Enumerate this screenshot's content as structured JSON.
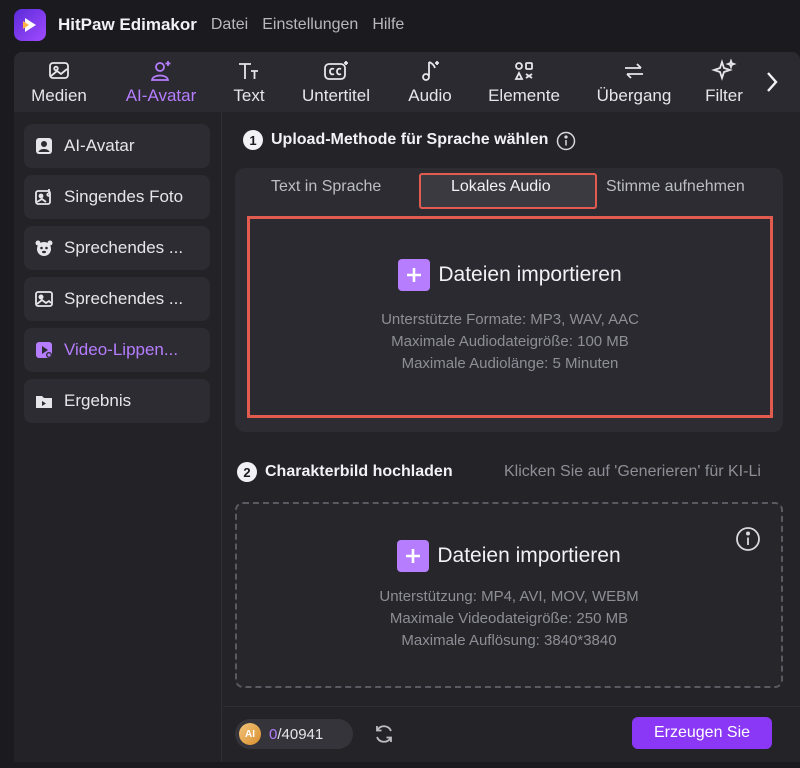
{
  "app": {
    "name": "HitPaw Edimakor"
  },
  "menu": [
    "Datei",
    "Einstellungen",
    "Hilfe"
  ],
  "toolbar": {
    "items": [
      {
        "label": "Medien",
        "icon": "media-icon"
      },
      {
        "label": "AI-Avatar",
        "icon": "ai-avatar-icon",
        "active": true
      },
      {
        "label": "Text",
        "icon": "text-icon"
      },
      {
        "label": "Untertitel",
        "icon": "subtitle-icon"
      },
      {
        "label": "Audio",
        "icon": "audio-icon"
      },
      {
        "label": "Elemente",
        "icon": "elements-icon"
      },
      {
        "label": "Übergang",
        "icon": "transition-icon"
      },
      {
        "label": "Filter",
        "icon": "filter-icon"
      }
    ],
    "next_icon": "chevron-right-icon"
  },
  "sidebar": {
    "items": [
      {
        "label": "AI-Avatar",
        "icon": "avatar-icon"
      },
      {
        "label": "Singendes Foto",
        "icon": "singing-photo-icon"
      },
      {
        "label": "Sprechendes ...",
        "icon": "talking-animal-icon"
      },
      {
        "label": "Sprechendes ...",
        "icon": "talking-photo-icon"
      },
      {
        "label": "Video-Lippen...",
        "icon": "lip-sync-icon",
        "active": true
      },
      {
        "label": "Ergebnis",
        "icon": "result-icon"
      }
    ]
  },
  "step1": {
    "number": "1",
    "title": "Upload-Methode für Sprache wählen",
    "tabs": [
      "Text in Sprache",
      "Lokales Audio",
      "Stimme aufnehmen"
    ],
    "selected_tab": "Lokales Audio",
    "import_label": "Dateien importieren",
    "notes": [
      "Unterstützte Formate: MP3, WAV, AAC",
      "Maximale Audiodateigröße: 100 MB",
      "Maximale Audiolänge: 5 Minuten"
    ]
  },
  "step2": {
    "number": "2",
    "title": "Charakterbild hochladen",
    "hint": "Klicken Sie auf 'Generieren' für KI-Li",
    "import_label": "Dateien importieren",
    "notes": [
      "Unterstützung: MP4, AVI, MOV, WEBM",
      "Maximale Videodateigröße: 250 MB",
      "Maximale Auflösung: 3840*3840"
    ]
  },
  "footer": {
    "credits_used": "0",
    "credits_total": "/40941",
    "coin_label": "AI",
    "generate_label": "Erzeugen Sie"
  },
  "colors": {
    "accent": "#b67dff",
    "highlight": "#e25b4f",
    "button": "#8a38f5"
  }
}
